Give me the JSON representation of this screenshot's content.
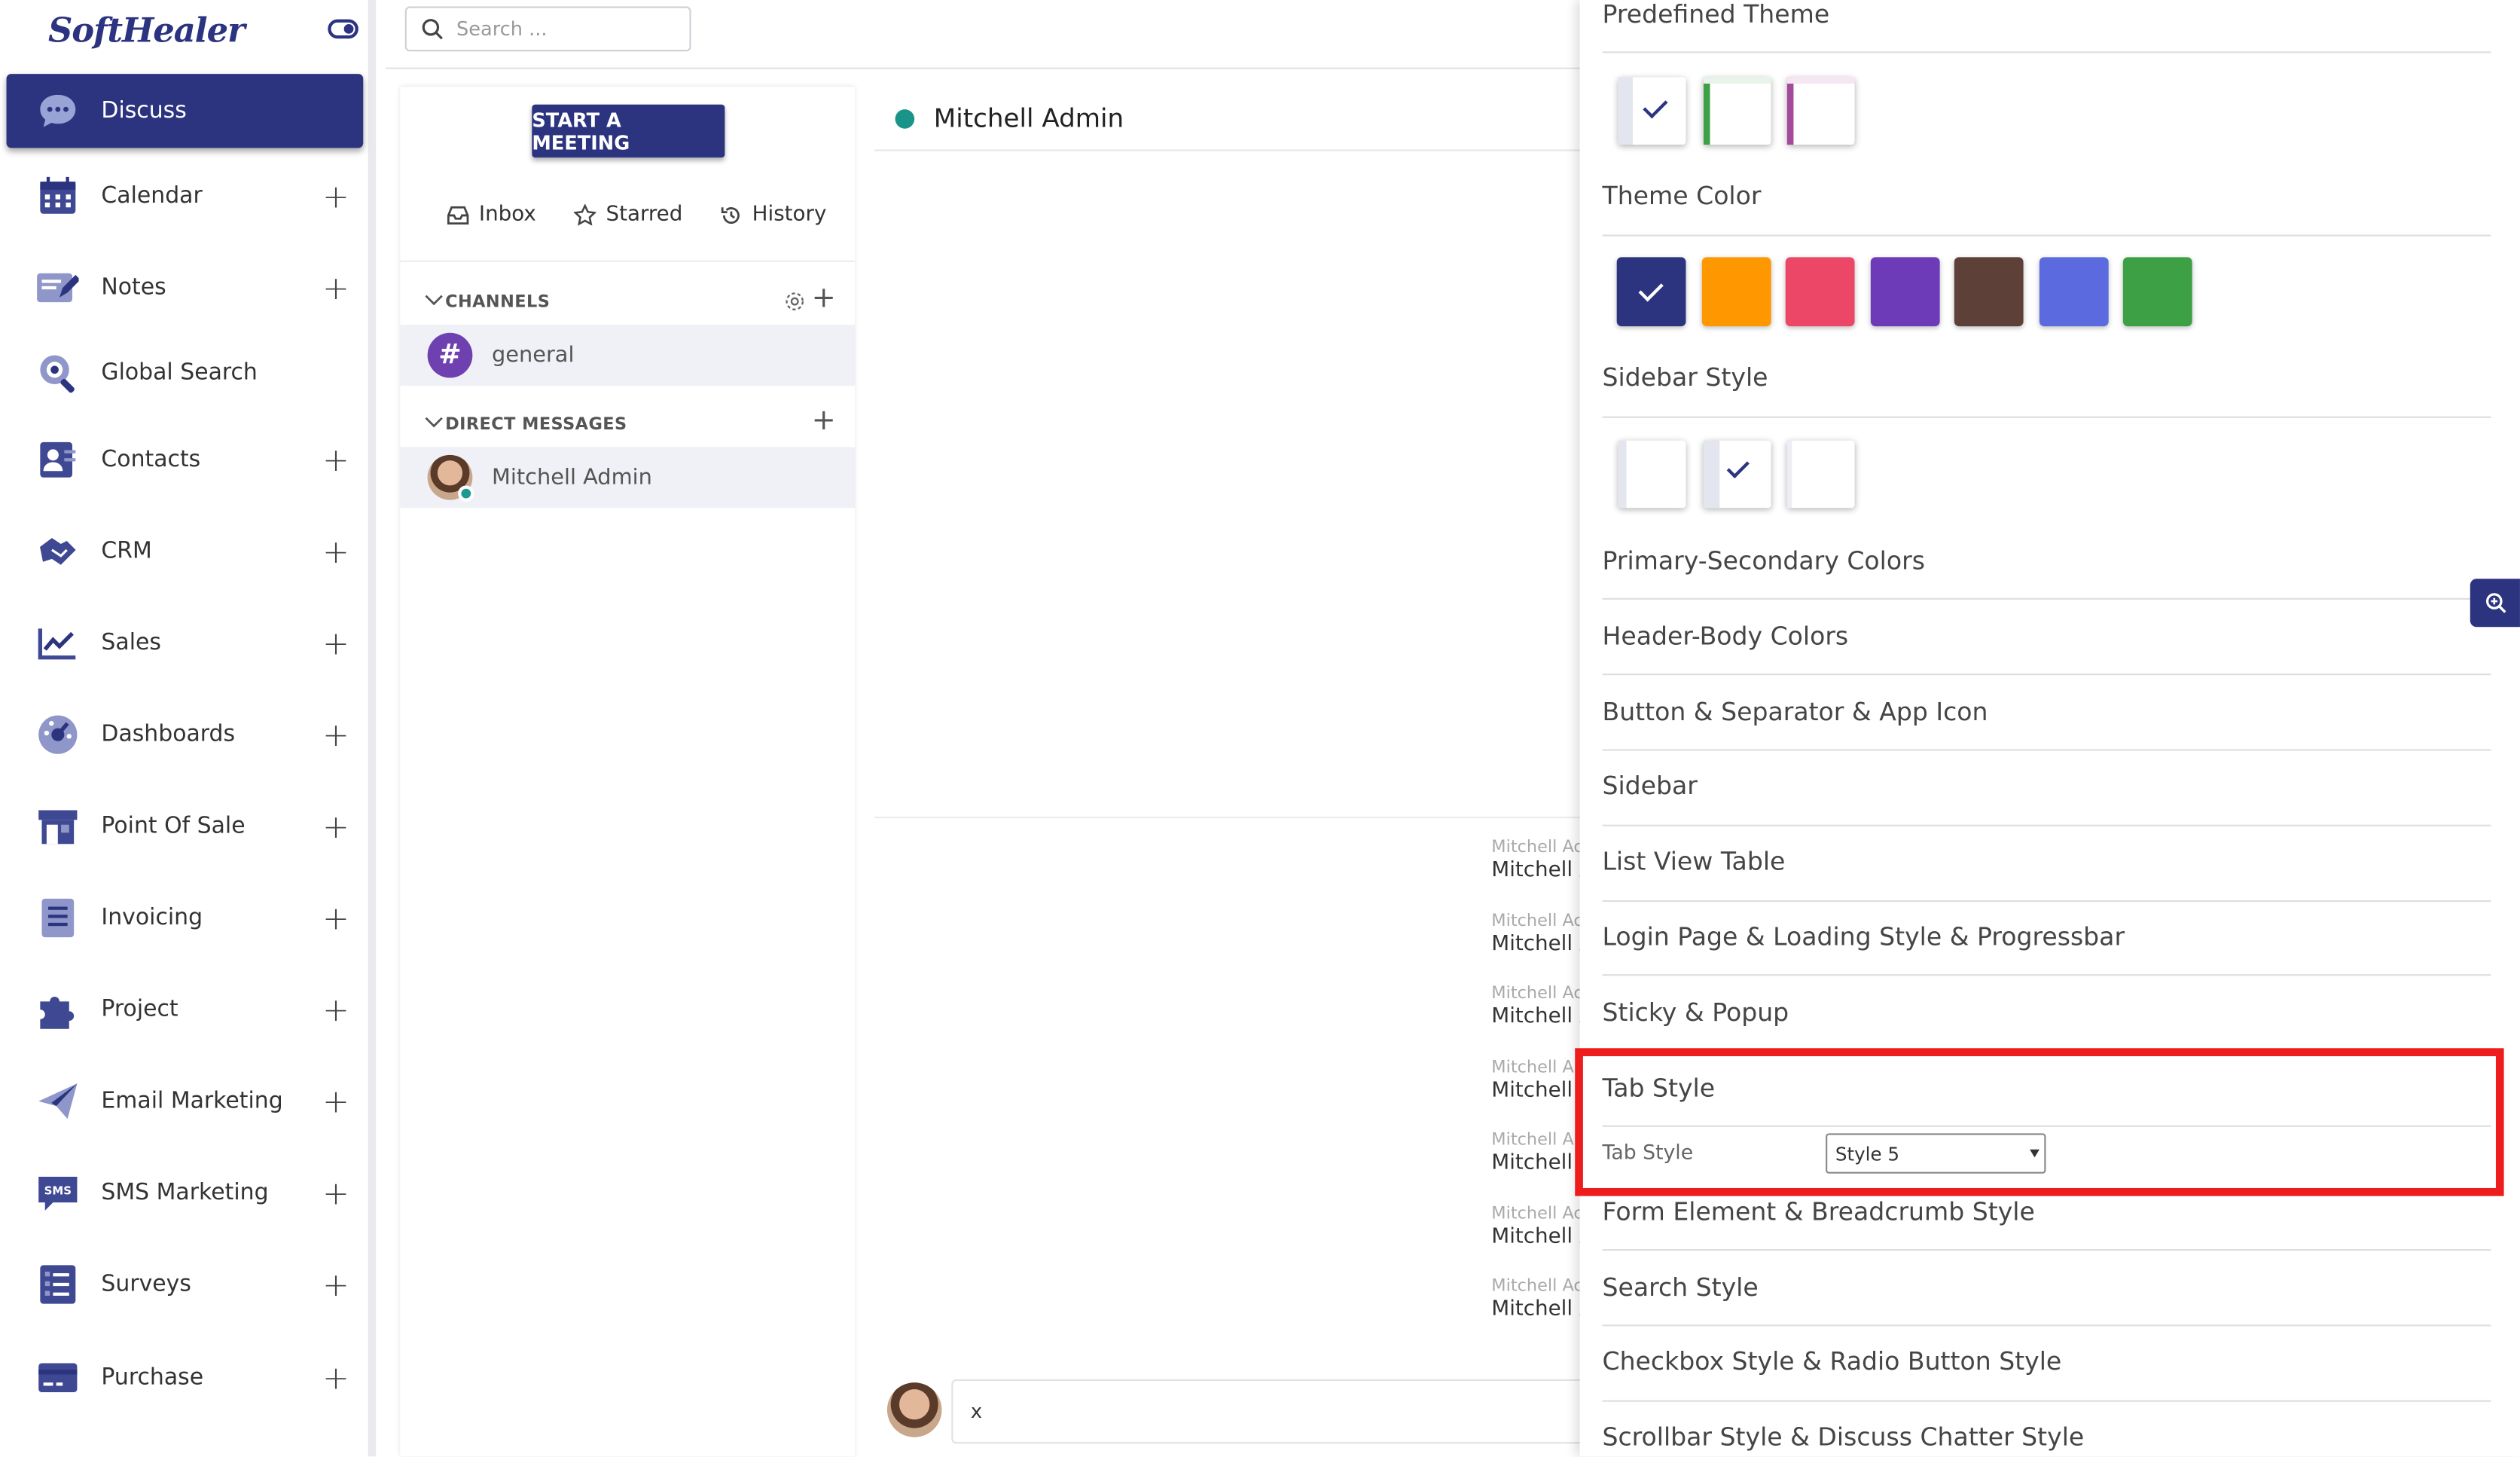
{
  "app": {
    "logo": "SoftHealer"
  },
  "sidebar": {
    "items": [
      {
        "label": "Discuss",
        "plus": ""
      },
      {
        "label": "Calendar",
        "plus": "+"
      },
      {
        "label": "Notes",
        "plus": "+"
      },
      {
        "label": "Global Search",
        "plus": ""
      },
      {
        "label": "Contacts",
        "plus": "+"
      },
      {
        "label": "CRM",
        "plus": "+"
      },
      {
        "label": "Sales",
        "plus": "+"
      },
      {
        "label": "Dashboards",
        "plus": "+"
      },
      {
        "label": "Point Of Sale",
        "plus": "+"
      },
      {
        "label": "Invoicing",
        "plus": "+"
      },
      {
        "label": "Project",
        "plus": "+"
      },
      {
        "label": "Email Marketing",
        "plus": "+"
      },
      {
        "label": "SMS Marketing",
        "plus": "+"
      },
      {
        "label": "Surveys",
        "plus": "+"
      },
      {
        "label": "Purchase",
        "plus": "+"
      }
    ]
  },
  "search": {
    "placeholder": "Search ..."
  },
  "discuss": {
    "meeting_button": "START A MEETING",
    "mailboxes": [
      "Inbox",
      "Starred",
      "History"
    ],
    "channels_title": "CHANNELS",
    "channels": [
      "general"
    ],
    "dm_title": "DIRECT MESSAGES",
    "direct_messages": [
      "Mitchell Admin"
    ]
  },
  "thread": {
    "title": "Mitchell Admin",
    "messages": [
      {
        "author": "Mitchell Ac",
        "body": "Mitchell A"
      },
      {
        "author": "Mitchell Ac",
        "body": "Mitchell A"
      },
      {
        "author": "Mitchell Ac",
        "body": "Mitchell A"
      },
      {
        "author": "Mitchell A",
        "body": "Mitchell"
      },
      {
        "author": "Mitchell A",
        "body": "Mitchell"
      },
      {
        "author": "Mitchell Ac",
        "body": "Mitchell A"
      },
      {
        "author": "Mitchell Ac",
        "body": "Mitchell A"
      }
    ],
    "composer_value": "x"
  },
  "settings": {
    "predefined_theme": "Predefined Theme",
    "theme_color": "Theme Color",
    "theme_colors": [
      "#2c3480",
      "#ff9800",
      "#ec4766",
      "#6d3ab8",
      "#5d4037",
      "#5b6ade",
      "#3da045"
    ],
    "sidebar_style": "Sidebar Style",
    "sections": [
      "Primary-Secondary Colors",
      "Header-Body Colors",
      "Button & Separator & App Icon",
      "Sidebar",
      "List View Table",
      "Login Page & Loading Style & Progressbar",
      "Sticky & Popup"
    ],
    "tab_style_title": "Tab Style",
    "tab_style_label": "Tab Style",
    "tab_style_value": "Style 5",
    "sections_after": [
      "Form Element & Breadcrumb Style",
      "Search Style",
      "Checkbox Style & Radio Button Style",
      "Scrollbar Style & Discuss Chatter Style"
    ]
  }
}
